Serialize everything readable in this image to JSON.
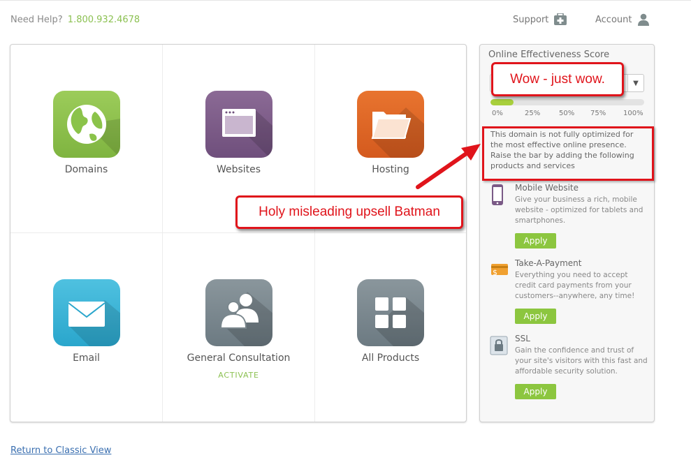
{
  "header": {
    "help_label": "Need Help?",
    "phone": "1.800.932.4678",
    "support_label": "Support",
    "account_label": "Account"
  },
  "tiles": [
    {
      "label": "Domains",
      "icon": "globe-icon"
    },
    {
      "label": "Websites",
      "icon": "browser-window-icon"
    },
    {
      "label": "Hosting",
      "icon": "folder-icon"
    },
    {
      "label": "Email",
      "icon": "envelope-icon"
    },
    {
      "label": "General Consultation",
      "icon": "people-icon",
      "sub": "ACTIVATE"
    },
    {
      "label": "All Products",
      "icon": "grid-icon"
    }
  ],
  "sidebar": {
    "title": "Online Effectiveness Score",
    "score_fraction": 0.15,
    "ticks": [
      "0%",
      "25%",
      "50%",
      "75%",
      "100%"
    ],
    "description": "This domain is not fully optimized for the most effective online presence. Raise the bar by adding the following products and services",
    "products": [
      {
        "name": "Mobile Website",
        "desc": "Give your business a rich, mobile website - optimized for tablets and smartphones.",
        "icon": "mobile-phone-icon",
        "apply": "Apply"
      },
      {
        "name": "Take-A-Payment",
        "desc": "Everything you need to accept credit card payments from your customers--anywhere, any time!",
        "icon": "credit-card-icon",
        "apply": "Apply"
      },
      {
        "name": "SSL",
        "desc": "Gain the confidence and trust of your site's visitors with this fast and affordable security solution.",
        "icon": "ssl-lock-icon",
        "apply": "Apply"
      }
    ]
  },
  "annotations": {
    "wow": "Wow - just wow.",
    "holy": "Holy misleading upsell Batman"
  },
  "footer": {
    "return_link": "Return to Classic View"
  },
  "colors": {
    "accent_green": "#8cc152",
    "annotation_red": "#e0141b",
    "link_blue": "#3a6fb0"
  }
}
